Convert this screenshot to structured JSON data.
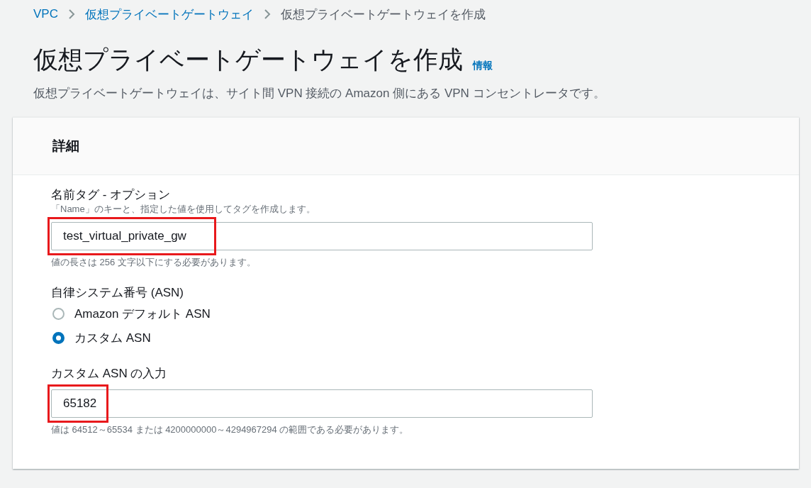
{
  "breadcrumb": [
    {
      "label": "VPC",
      "link": true
    },
    {
      "label": "仮想プライベートゲートウェイ",
      "link": true
    },
    {
      "label": "仮想プライベートゲートウェイを作成",
      "link": false
    }
  ],
  "title": "仮想プライベートゲートウェイを作成",
  "info_link": "情報",
  "description": "仮想プライベートゲートウェイは、サイト間 VPN 接続の Amazon 側にある VPN コンセントレータです。",
  "panel": {
    "heading": "詳細",
    "fields": [
      {
        "kind": "text",
        "label": "名前タグ - オプション",
        "hint": "「Name」のキーと、指定した値を使用してタグを作成します。",
        "value": "test_virtual_private_gw",
        "highlighted": true,
        "help": "値の長さは 256 文字以下にする必要があります。"
      },
      {
        "kind": "radio",
        "label": "自律システム番号 (ASN)",
        "options": [
          {
            "label": "Amazon デフォルト ASN",
            "selected": false
          },
          {
            "label": "カスタム ASN",
            "selected": true
          }
        ]
      },
      {
        "kind": "text",
        "label": "カスタム ASN の入力",
        "value": "65182",
        "highlighted": true,
        "help": "値は 64512～65534 または 4200000000～4294967294 の範囲である必要があります。"
      }
    ]
  }
}
